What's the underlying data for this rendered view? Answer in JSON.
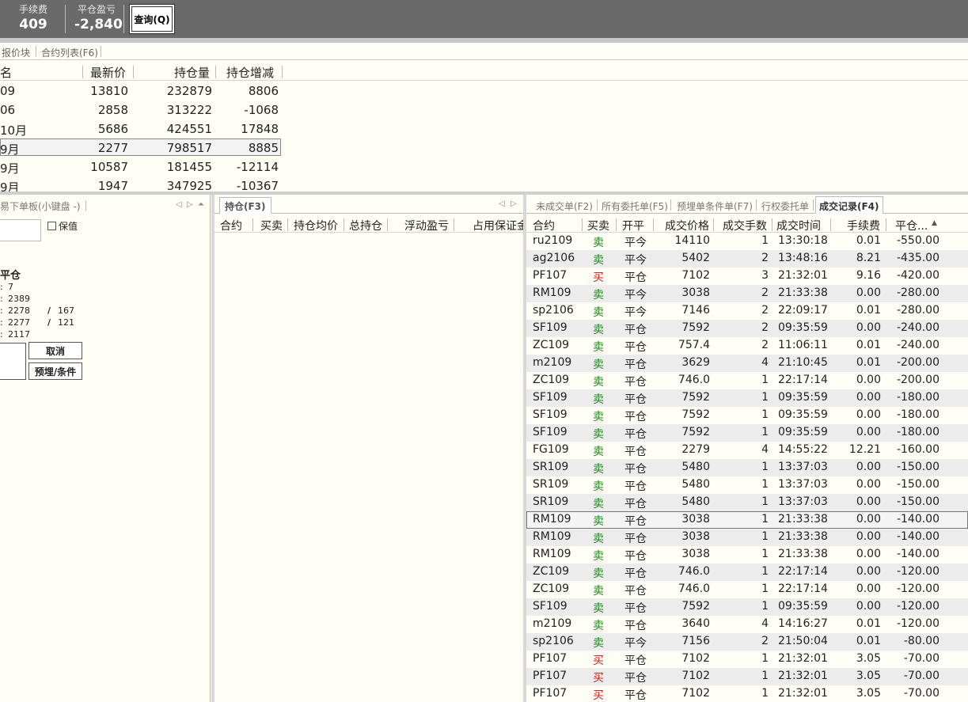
{
  "summary": {
    "fee_label": "手续费",
    "fee_value": "409",
    "pnl_label": "平仓盈亏",
    "pnl_value": "-2,840",
    "query_button": "查询(Q)"
  },
  "quote_tabs": [
    "报价块",
    "合约列表(F6)"
  ],
  "quote_table": {
    "headers": [
      "名",
      "最新价",
      "持仓量",
      "持仓增减"
    ],
    "rows": [
      {
        "name": "09",
        "last": "13810",
        "oi": "232879",
        "oi_change": "8806"
      },
      {
        "name": "06",
        "last": "2858",
        "oi": "313222",
        "oi_change": "-1068"
      },
      {
        "name": "10月",
        "last": "5686",
        "oi": "424551",
        "oi_change": "17848"
      },
      {
        "name": "9月",
        "last": "2277",
        "oi": "798517",
        "oi_change": "8885"
      },
      {
        "name": "9月",
        "last": "10587",
        "oi": "181455",
        "oi_change": "-12114"
      },
      {
        "name": "9月",
        "last": "1947",
        "oi": "347925",
        "oi_change": "-10367"
      }
    ],
    "selected_row": 3
  },
  "order_panel": {
    "title": "易下单板(小键盘 -)",
    "hedge_label": "保值",
    "close_title": "平仓",
    "book": [
      {
        "c": ":",
        "v": "7"
      },
      {
        "c": ":",
        "v": "2389"
      },
      {
        "c": ":",
        "v": "2278",
        "s": "/",
        "q": "167"
      },
      {
        "c": ":",
        "v": "2277",
        "s": "/",
        "q": "121"
      },
      {
        "c": ":",
        "v": "2117"
      }
    ],
    "cancel_button": "取消",
    "condition_button": "预埋/条件"
  },
  "positions": {
    "tab": "持仓(F3)",
    "headers": [
      "合约",
      "买卖",
      "持仓均价",
      "总持仓",
      "浮动盈亏",
      "占用保证金"
    ]
  },
  "trades": {
    "tabs": [
      "未成交单(F2)",
      "所有委托单(F5)",
      "预埋单条件单(F7)",
      "行权委托单",
      "成交记录(F4)"
    ],
    "active_tab": 4,
    "headers": [
      "合约",
      "买卖",
      "开平",
      "成交价格",
      "成交手数",
      "成交时间",
      "手续费",
      "平仓..."
    ],
    "sort_icon": "sort-up-icon",
    "colors": {
      "sell": "#1a8a1a",
      "buy": "#d42020"
    },
    "selected_row": 16,
    "rows": [
      [
        "ru2109",
        "卖",
        "平今",
        "14110",
        "1",
        "13:30:18",
        "0.01",
        "-550.00"
      ],
      [
        "ag2106",
        "卖",
        "平今",
        "5402",
        "2",
        "13:48:16",
        "8.21",
        "-435.00"
      ],
      [
        "PF107",
        "买",
        "平仓",
        "7102",
        "3",
        "21:32:01",
        "9.16",
        "-420.00"
      ],
      [
        "RM109",
        "卖",
        "平今",
        "3038",
        "2",
        "21:33:38",
        "0.00",
        "-280.00"
      ],
      [
        "sp2106",
        "卖",
        "平今",
        "7146",
        "2",
        "22:09:17",
        "0.01",
        "-280.00"
      ],
      [
        "SF109",
        "卖",
        "平仓",
        "7592",
        "2",
        "09:35:59",
        "0.00",
        "-240.00"
      ],
      [
        "ZC109",
        "卖",
        "平仓",
        "757.4",
        "2",
        "11:06:11",
        "0.01",
        "-240.00"
      ],
      [
        "m2109",
        "卖",
        "平仓",
        "3629",
        "4",
        "21:10:45",
        "0.01",
        "-200.00"
      ],
      [
        "ZC109",
        "卖",
        "平仓",
        "746.0",
        "1",
        "22:17:14",
        "0.00",
        "-200.00"
      ],
      [
        "SF109",
        "卖",
        "平仓",
        "7592",
        "1",
        "09:35:59",
        "0.00",
        "-180.00"
      ],
      [
        "SF109",
        "卖",
        "平仓",
        "7592",
        "1",
        "09:35:59",
        "0.00",
        "-180.00"
      ],
      [
        "SF109",
        "卖",
        "平仓",
        "7592",
        "1",
        "09:35:59",
        "0.00",
        "-180.00"
      ],
      [
        "FG109",
        "卖",
        "平仓",
        "2279",
        "4",
        "14:55:22",
        "12.21",
        "-160.00"
      ],
      [
        "SR109",
        "卖",
        "平仓",
        "5480",
        "1",
        "13:37:03",
        "0.00",
        "-150.00"
      ],
      [
        "SR109",
        "卖",
        "平仓",
        "5480",
        "1",
        "13:37:03",
        "0.00",
        "-150.00"
      ],
      [
        "SR109",
        "卖",
        "平仓",
        "5480",
        "1",
        "13:37:03",
        "0.00",
        "-150.00"
      ],
      [
        "RM109",
        "卖",
        "平仓",
        "3038",
        "1",
        "21:33:38",
        "0.00",
        "-140.00"
      ],
      [
        "RM109",
        "卖",
        "平仓",
        "3038",
        "1",
        "21:33:38",
        "0.00",
        "-140.00"
      ],
      [
        "RM109",
        "卖",
        "平仓",
        "3038",
        "1",
        "21:33:38",
        "0.00",
        "-140.00"
      ],
      [
        "ZC109",
        "卖",
        "平仓",
        "746.0",
        "1",
        "22:17:14",
        "0.00",
        "-120.00"
      ],
      [
        "ZC109",
        "卖",
        "平仓",
        "746.0",
        "1",
        "22:17:14",
        "0.00",
        "-120.00"
      ],
      [
        "SF109",
        "卖",
        "平仓",
        "7592",
        "1",
        "09:35:59",
        "0.00",
        "-120.00"
      ],
      [
        "m2109",
        "卖",
        "平仓",
        "3640",
        "4",
        "14:16:27",
        "0.01",
        "-120.00"
      ],
      [
        "sp2106",
        "卖",
        "平今",
        "7156",
        "2",
        "21:50:04",
        "0.01",
        "-80.00"
      ],
      [
        "PF107",
        "买",
        "平仓",
        "7102",
        "1",
        "21:32:01",
        "3.05",
        "-70.00"
      ],
      [
        "PF107",
        "买",
        "平仓",
        "7102",
        "1",
        "21:32:01",
        "3.05",
        "-70.00"
      ],
      [
        "PF107",
        "买",
        "平仓",
        "7102",
        "1",
        "21:32:01",
        "3.05",
        "-70.00"
      ]
    ]
  }
}
